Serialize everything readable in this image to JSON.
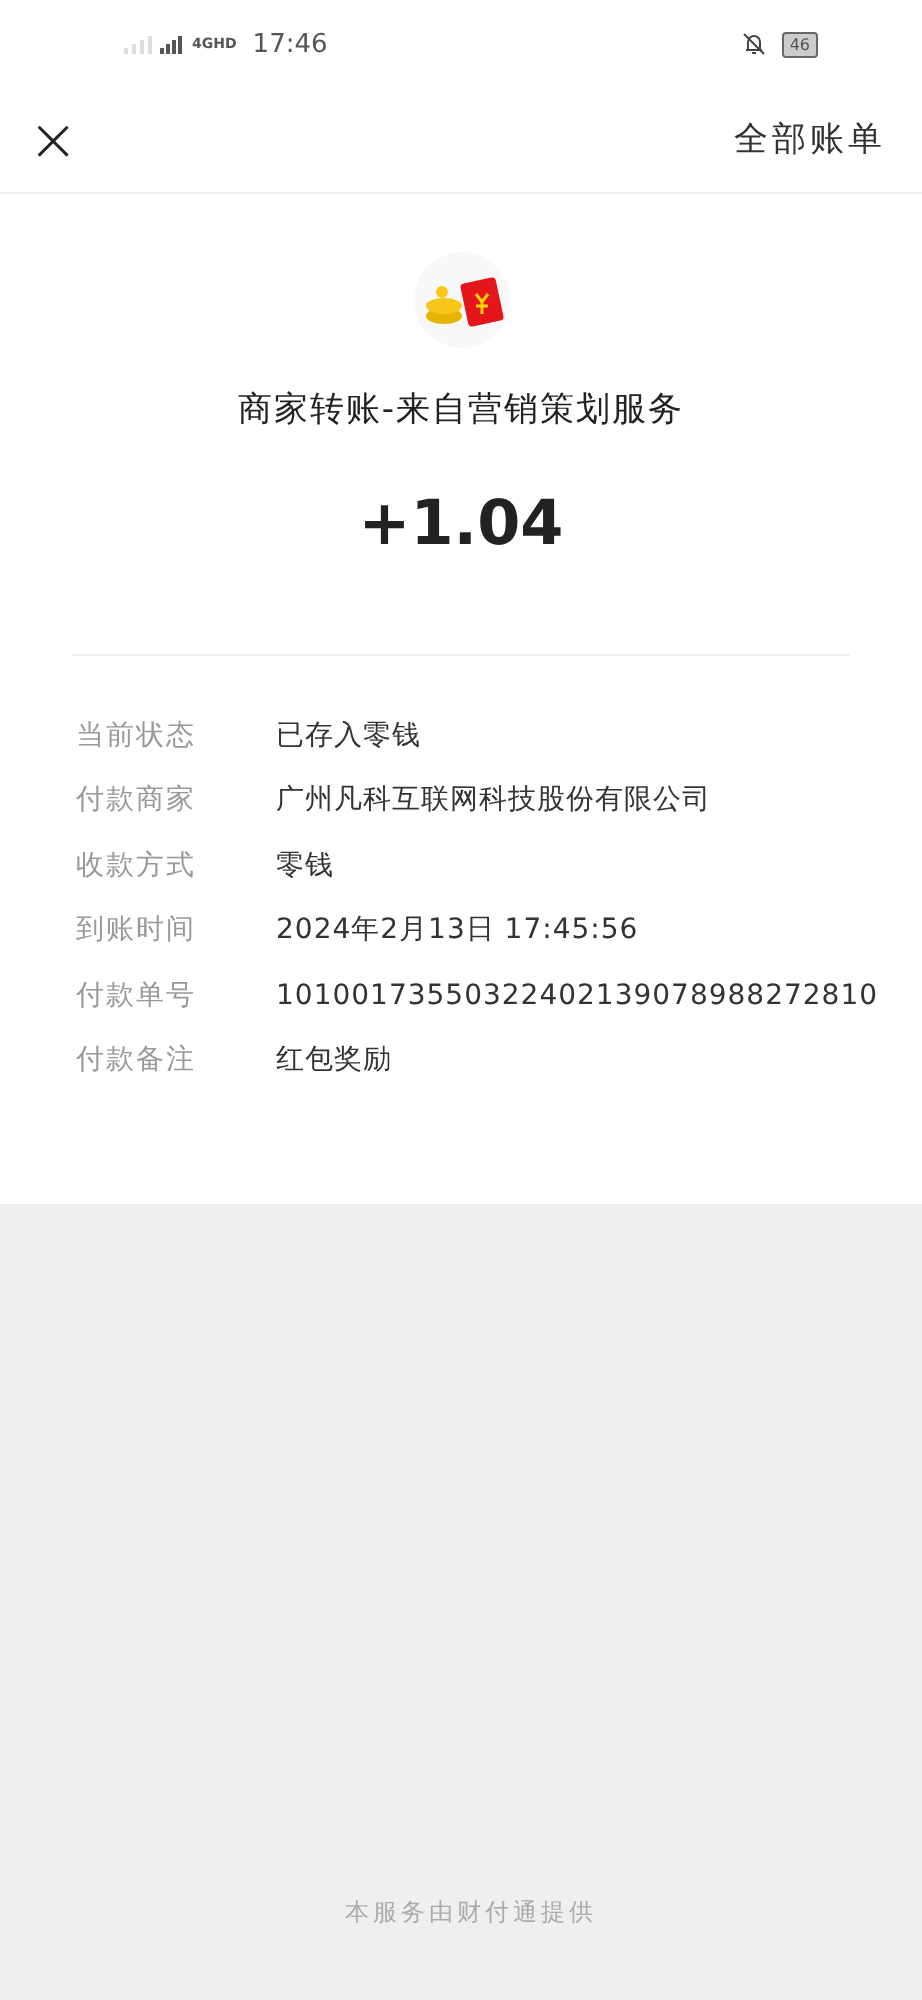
{
  "status_bar": {
    "network": "4GHD",
    "time": "17:46",
    "battery": "46"
  },
  "header": {
    "close": "×",
    "action": "全部账单"
  },
  "title": "商家转账-来自营销策划服务",
  "amount": "+1.04",
  "details": [
    {
      "label": "当前状态",
      "value": "已存入零钱"
    },
    {
      "label": "付款商家",
      "value": "广州凡科互联网科技股份有限公司"
    },
    {
      "label": "收款方式",
      "value": "零钱"
    },
    {
      "label": "到账时间",
      "value": "2024年2月13日 17:45:56"
    },
    {
      "label": "付款单号",
      "value": "10100173550322402139078988272810"
    },
    {
      "label": "付款备注",
      "value": "红包奖励"
    }
  ],
  "footer": "本服务由财付通提供"
}
